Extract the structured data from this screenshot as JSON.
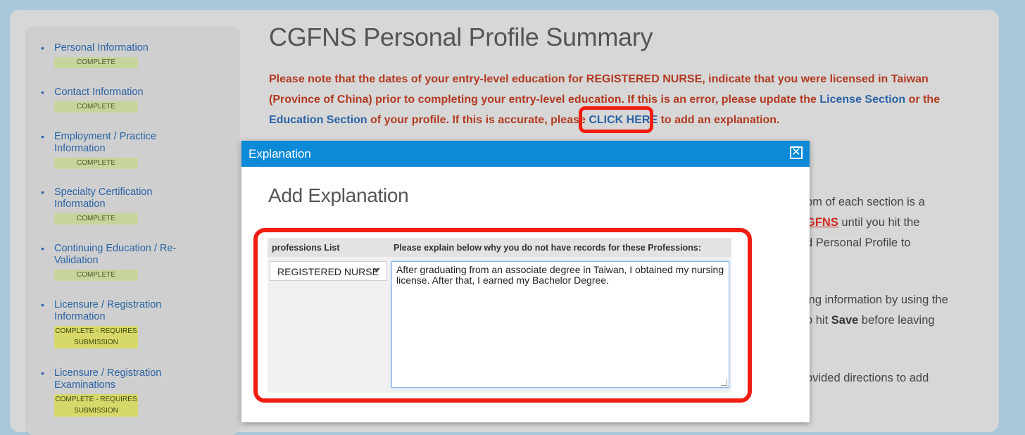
{
  "page": {
    "title": "CGFNS Personal Profile Summary",
    "notice": {
      "part1": "Please note that the dates of your entry-level education for REGISTERED NURSE, indicate that you were licensed in Taiwan (Province of China) prior to completing your entry-level education. If this is an error, please update the ",
      "license_link": "License Section",
      "part2": " or the ",
      "education_link": "Education Section",
      "part3": " of your profile. If this is accurate, please ",
      "click_here": "CLICK HERE",
      "part4": " to add an explanation."
    },
    "background_lines": {
      "l1": "om of each section is a",
      "l2_link": "GFNS",
      "l2_rest": " until you hit the",
      "l3": "d Personal Profile to",
      "l4": "ing information by using the",
      "l5_pre": "o hit ",
      "l5_bold": "Save",
      "l5_post": " before leaving",
      "l6": "ovided directions to add"
    }
  },
  "sidebar": {
    "items": [
      {
        "label": "Personal Information",
        "status": "COMPLETE"
      },
      {
        "label": "Contact Information",
        "status": "COMPLETE"
      },
      {
        "label": "Employment / Practice Information",
        "status": "COMPLETE"
      },
      {
        "label": "Specialty Certification Information",
        "status": "COMPLETE"
      },
      {
        "label": "Continuing Education / Re-Validation",
        "status": "COMPLETE"
      },
      {
        "label": "Licensure / Registration Information",
        "status": "COMPLETE - REQUIRES SUBMISSION"
      },
      {
        "label": "Licensure / Registration Examinations",
        "status": "COMPLETE - REQUIRES SUBMISSION"
      }
    ]
  },
  "modal": {
    "title": "Explanation",
    "close_symbol": "✕",
    "heading": "Add Explanation",
    "table": {
      "col1_header": "professions List",
      "col2_header": "Please explain below why you do not have records for these Professions:",
      "selected_profession": "REGISTERED NURSE",
      "explanation_text": "After graduating from an associate degree in Taiwan, I obtained my nursing license. After that, I earned my Bachelor Degree."
    }
  },
  "colors": {
    "accent": "#0c8ad8",
    "link": "#2a63a6",
    "warning_text": "#b23a20",
    "highlight_ring": "#f01e12"
  }
}
